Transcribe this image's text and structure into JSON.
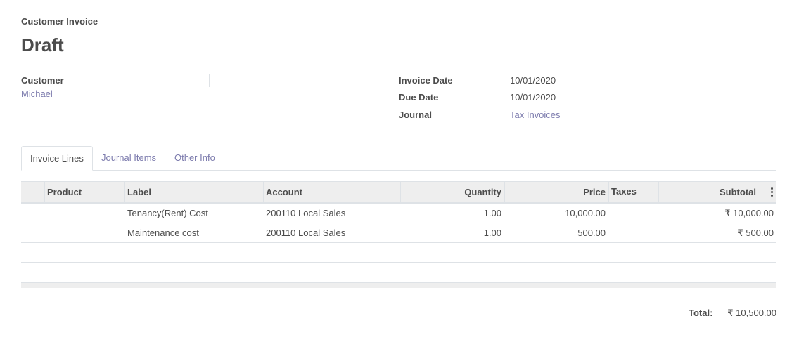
{
  "header": {
    "doc_type": "Customer Invoice",
    "state": "Draft"
  },
  "customer": {
    "label": "Customer",
    "value": "Michael"
  },
  "dates": {
    "invoice_date_label": "Invoice Date",
    "invoice_date": "10/01/2020",
    "due_date_label": "Due Date",
    "due_date": "10/01/2020",
    "journal_label": "Journal",
    "journal": "Tax Invoices"
  },
  "tabs": [
    {
      "label": "Invoice Lines",
      "active": true
    },
    {
      "label": "Journal Items",
      "active": false
    },
    {
      "label": "Other Info",
      "active": false
    }
  ],
  "table": {
    "columns": [
      "Product",
      "Label",
      "Account",
      "Quantity",
      "Price",
      "Taxes",
      "Subtotal"
    ],
    "rows": [
      {
        "product": "",
        "label": "Tenancy(Rent) Cost",
        "account": "200110 Local Sales",
        "quantity": "1.00",
        "price": "10,000.00",
        "taxes": "",
        "subtotal": "₹ 10,000.00"
      },
      {
        "product": "",
        "label": "Maintenance cost",
        "account": "200110 Local Sales",
        "quantity": "1.00",
        "price": "500.00",
        "taxes": "",
        "subtotal": "₹ 500.00"
      }
    ],
    "column_options_icon": "kebab-vertical-icon"
  },
  "totals": {
    "label": "Total:",
    "value": "₹ 10,500.00"
  }
}
